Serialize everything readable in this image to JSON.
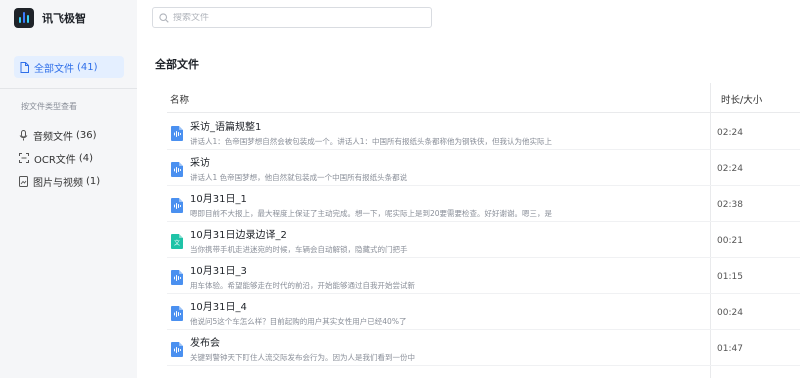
{
  "app": {
    "name": "讯飞极智"
  },
  "sidebar": {
    "all_files": {
      "label": "全部文件",
      "count": "(41)"
    },
    "group_label": "按文件类型查看",
    "items": [
      {
        "label": "音频文件",
        "count": "(36)",
        "icon": "microphone-icon"
      },
      {
        "label": "OCR文件",
        "count": "(4)",
        "icon": "ocr-scan-icon"
      },
      {
        "label": "图片与视频",
        "count": "(1)",
        "icon": "image-icon"
      }
    ]
  },
  "search": {
    "placeholder": "搜索文件"
  },
  "main": {
    "title": "全部文件",
    "columns": {
      "name": "名称",
      "duration": "时长/大小"
    },
    "files": [
      {
        "name": "采访_语篇规整1",
        "desc": "讲话人1：色帝国梦想自然会被包装成一个。讲话人1：中国所有报纸头条都称他为钢铁侠，但我认为他实际上",
        "duration": "02:24",
        "type": "audio"
      },
      {
        "name": "采访",
        "desc": "讲话人1 色帝国梦想，他自然就包装成一个中国所有报纸头条都说",
        "duration": "02:24",
        "type": "audio"
      },
      {
        "name": "10月31日_1",
        "desc": "嗯即目前不大报上，最大程度上保证了主动完成。想一下，呢实际上是到20要需要检查。好好谢谢。嗯三，是",
        "duration": "02:38",
        "type": "audio"
      },
      {
        "name": "10月31日边录边译_2",
        "desc": "当你携带手机走进迷宛的时候，车辆会自动解锁，隐藏式的门把手",
        "duration": "00:21",
        "type": "translate"
      },
      {
        "name": "10月31日_3",
        "desc": "用车体验。希望能够走在时代的前沿，开始能够通过自我开始尝试新",
        "duration": "01:15",
        "type": "audio"
      },
      {
        "name": "10月31日_4",
        "desc": "他说问5这个车怎么样？目前起购的用户其实女性用户已经40%了",
        "duration": "00:24",
        "type": "audio"
      },
      {
        "name": "发布会",
        "desc": "关键到警钟天下盯住人流交际发布会行为。因为人是我们看到一份中",
        "duration": "01:47",
        "type": "audio"
      }
    ]
  },
  "colors": {
    "accent": "#2f6fe9",
    "audio_icon": "#4a90f0",
    "translate_icon": "#1fc3a7"
  }
}
